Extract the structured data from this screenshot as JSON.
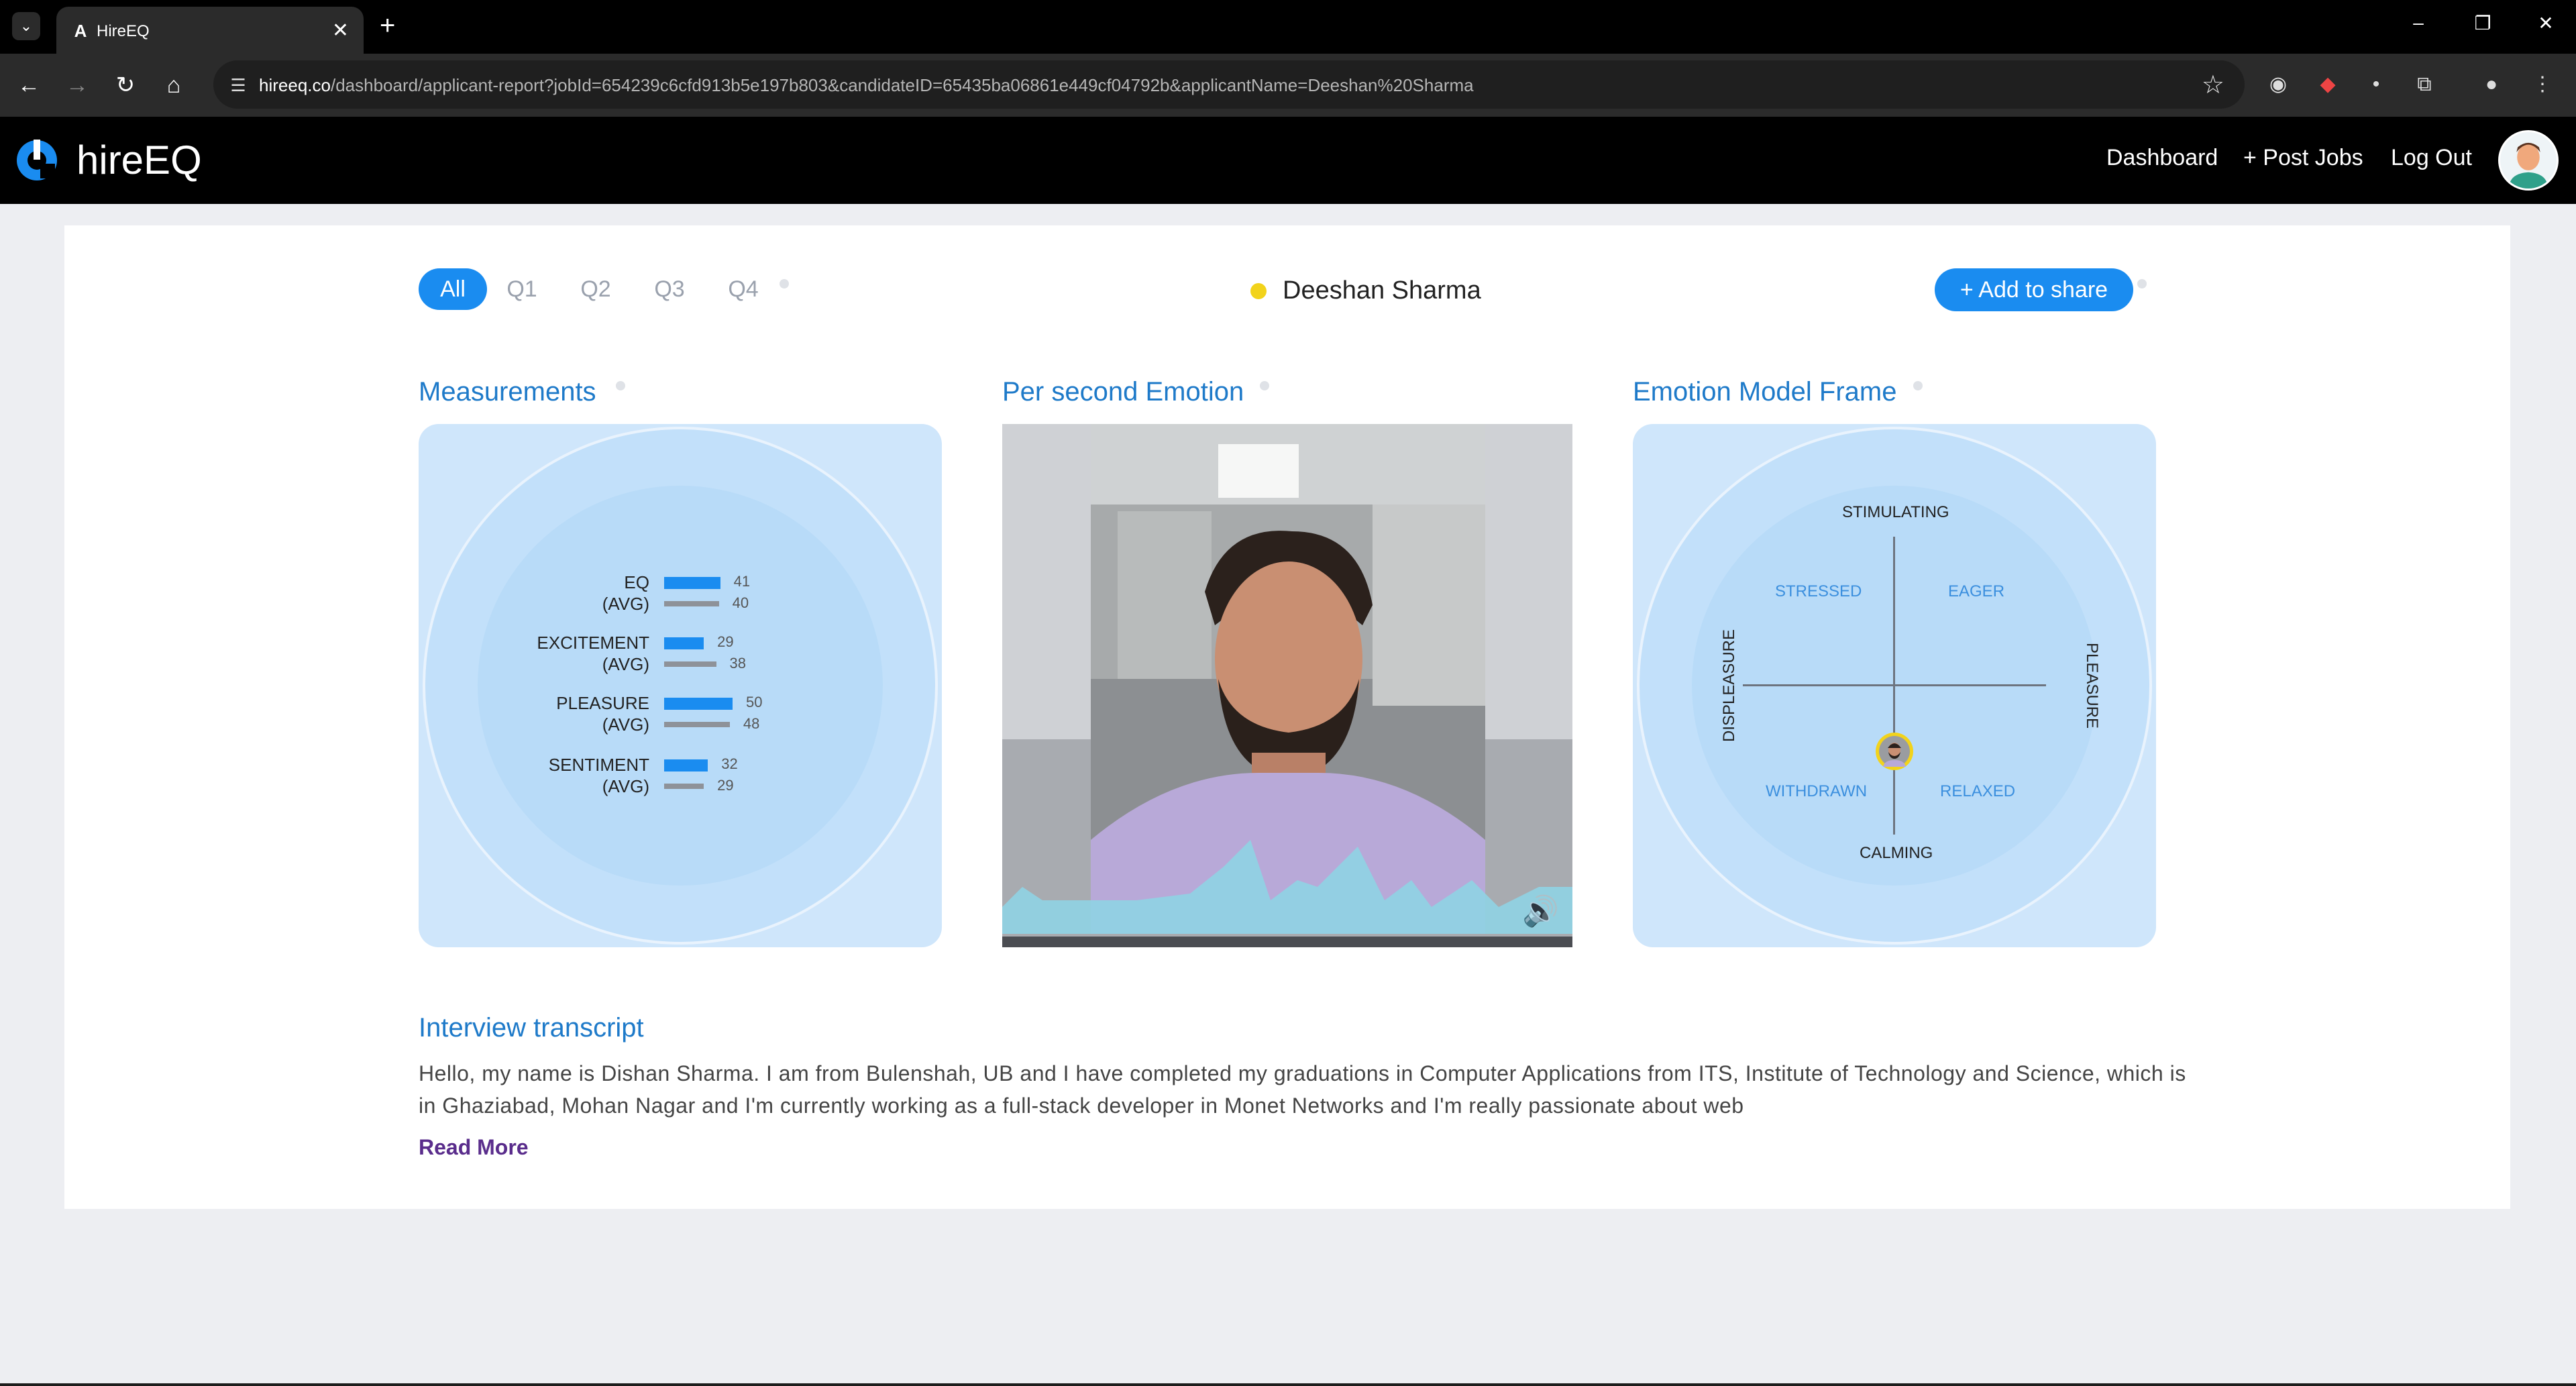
{
  "browser": {
    "tab_title": "HireEQ",
    "tab_favicon": "A",
    "url_host": "hireeq.co",
    "url_path": "/dashboard/applicant-report?jobId=654239c6cfd913b5e197b803&candidateID=65435ba06861e449cf04792b&applicantName=Deeshan%20Sharma",
    "icons": [
      "tab-menu-icon",
      "close-icon",
      "plus-icon",
      "minimize-icon",
      "restore-icon",
      "back-icon",
      "forward-icon",
      "reload-icon",
      "home-icon",
      "site-settings-icon",
      "star-icon",
      "extensions-icon",
      "menu-icon"
    ]
  },
  "app": {
    "brand": "hireEQ",
    "nav": {
      "dashboard": "Dashboard",
      "post_jobs": "+ Post Jobs",
      "logout": "Log Out"
    }
  },
  "report": {
    "filters": [
      "All",
      "Q1",
      "Q2",
      "Q3",
      "Q4"
    ],
    "active_filter": "All",
    "candidate_name": "Deeshan Sharma",
    "share_button": "+ Add to share",
    "status_color": "#f2d31b",
    "accent_color": "#1a8cf0"
  },
  "sections": {
    "measurements": "Measurements",
    "per_second": "Per second Emotion",
    "emotion_model": "Emotion Model Frame",
    "transcript": "Interview transcript"
  },
  "measurements": [
    {
      "label": "EQ",
      "value": 41,
      "avg_label": "(AVG)",
      "avg": 40
    },
    {
      "label": "EXCITEMENT",
      "value": 29,
      "avg_label": "(AVG)",
      "avg": 38
    },
    {
      "label": "PLEASURE",
      "value": 50,
      "avg_label": "(AVG)",
      "avg": 48
    },
    {
      "label": "SENTIMENT",
      "value": 32,
      "avg_label": "(AVG)",
      "avg": 29
    }
  ],
  "emotion_model": {
    "top": "STIMULATING",
    "bottom": "CALMING",
    "left": "DISPLEASURE",
    "right": "PLEASURE",
    "quadrants": {
      "top_left": "STRESSED",
      "top_right": "EAGER",
      "bottom_left": "WITHDRAWN",
      "bottom_right": "RELAXED"
    }
  },
  "transcript": {
    "text": "Hello, my name is Dishan Sharma. I am from Bulenshah, UB and I have completed my graduations in Computer Applications from ITS, Institute of Technology and Science, which is in Ghaziabad, Mohan Nagar and I'm currently working as a full-stack developer in Monet Networks and I'm really passionate about web",
    "read_more": "Read More"
  }
}
